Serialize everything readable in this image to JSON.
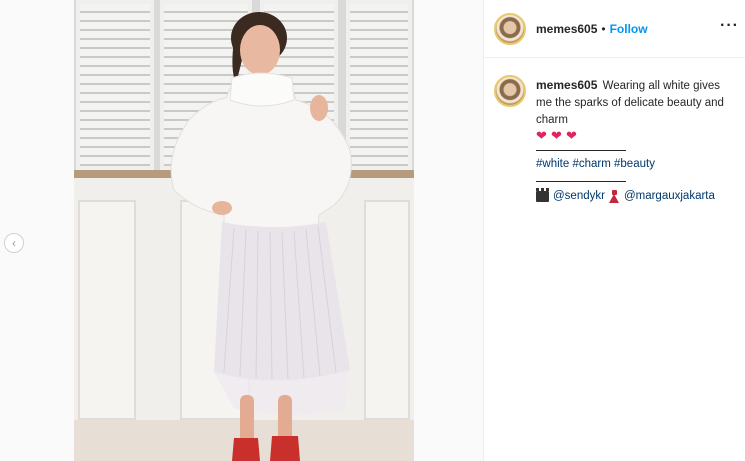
{
  "post": {
    "username": "memes605",
    "dot": "•",
    "follow_label": "Follow",
    "more_icon": "more-options-icon",
    "more_glyph": "···"
  },
  "caption": {
    "username": "memes605",
    "text": "Wearing all white gives me the sparks of delicate beauty and charm",
    "hearts": [
      "❤",
      "❤",
      "❤"
    ],
    "hashtags": [
      "#white",
      "#charm",
      "#beauty"
    ],
    "credit_1": "@sendykr",
    "credit_2": "@margauxjakarta",
    "credit_1_icon": "clapperboard-icon",
    "credit_2_icon": "dress-icon"
  },
  "nav": {
    "prev_glyph": "‹",
    "prev_icon": "chevron-left-icon"
  },
  "colors": {
    "link": "#0095f6",
    "hashtag": "#00376b",
    "heart": "#e0245e",
    "dress_red": "#c4283f"
  }
}
